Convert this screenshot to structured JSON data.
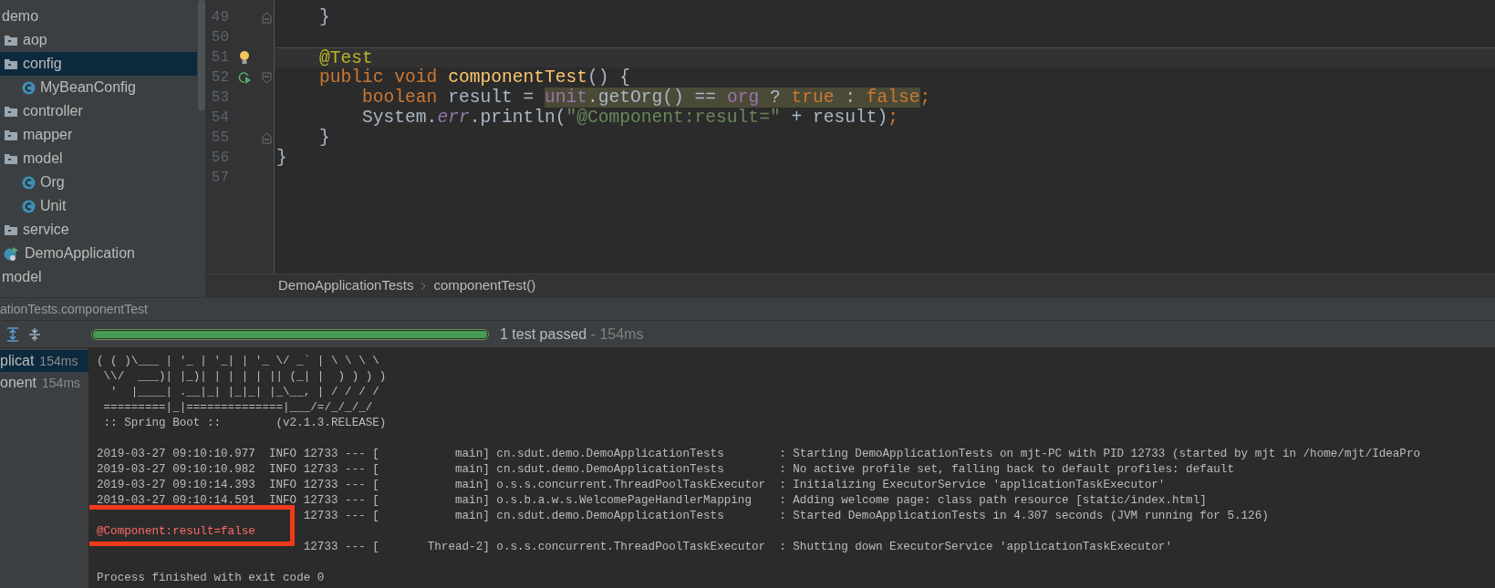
{
  "project_tree": [
    {
      "label": "demo",
      "kind": "module",
      "selected": false,
      "children": [
        {
          "label": "aop",
          "kind": "folder",
          "selected": false
        },
        {
          "label": "config",
          "kind": "folder",
          "selected": true,
          "children": [
            {
              "label": "MyBeanConfig",
              "kind": "class",
              "selected": false
            }
          ]
        },
        {
          "label": "controller",
          "kind": "folder",
          "selected": false
        },
        {
          "label": "mapper",
          "kind": "folder",
          "selected": false
        },
        {
          "label": "model",
          "kind": "folder",
          "selected": false,
          "children": [
            {
              "label": "Org",
              "kind": "class",
              "selected": false
            },
            {
              "label": "Unit",
              "kind": "class",
              "selected": false
            }
          ]
        },
        {
          "label": "service",
          "kind": "folder",
          "selected": false
        },
        {
          "label": "DemoApplication",
          "kind": "app",
          "selected": false
        }
      ]
    },
    {
      "label": "model",
      "kind": "module",
      "selected": false
    }
  ],
  "editor": {
    "lines": [
      {
        "number": "49",
        "fold_end": true,
        "current": false,
        "tokens": [
          {
            "kind": "plain",
            "text": "    }"
          }
        ]
      },
      {
        "number": "50",
        "current": false
      },
      {
        "number": "51",
        "current": true,
        "bulb": true,
        "tokens": [
          {
            "kind": "annotation",
            "text": "    @Test"
          }
        ]
      },
      {
        "number": "52",
        "fold_start": true,
        "current": false,
        "run_marker": true,
        "tokens": [
          {
            "kind": "keyword",
            "text": "    public void "
          },
          {
            "kind": "method",
            "text": "componentTest"
          },
          {
            "kind": "plain",
            "text": "() {"
          }
        ]
      },
      {
        "number": "53",
        "current": false,
        "tokens": [
          {
            "kind": "keyword",
            "text": "        boolean "
          },
          {
            "kind": "plain",
            "text": "result = "
          },
          {
            "kind": "field",
            "text": "unit",
            "marked": true
          },
          {
            "kind": "plain",
            "text": ".getOrg() == ",
            "marked": true
          },
          {
            "kind": "field",
            "text": "org",
            "marked": true
          },
          {
            "kind": "plain",
            "text": " ? ",
            "marked": true
          },
          {
            "kind": "keyword",
            "text": "true",
            "marked": true
          },
          {
            "kind": "plain",
            "text": " : ",
            "marked": true
          },
          {
            "kind": "keyword",
            "text": "false",
            "marked": true
          },
          {
            "kind": "keyword",
            "text": ";"
          }
        ]
      },
      {
        "number": "54",
        "current": false,
        "tokens": [
          {
            "kind": "plain",
            "text": "        System."
          },
          {
            "kind": "static",
            "text": "err"
          },
          {
            "kind": "plain",
            "text": ".println("
          },
          {
            "kind": "string",
            "text": "\"@Component:result=\""
          },
          {
            "kind": "plain",
            "text": " + result)"
          },
          {
            "kind": "keyword",
            "text": ";"
          }
        ]
      },
      {
        "number": "55",
        "fold_end": true,
        "current": false,
        "tokens": [
          {
            "kind": "plain",
            "text": "    }"
          }
        ]
      },
      {
        "number": "56",
        "current": false,
        "tokens": [
          {
            "kind": "plain",
            "text": "}"
          }
        ]
      },
      {
        "number": "57",
        "current": false
      }
    ]
  },
  "breadcrumbs": [
    "DemoApplicationTests",
    "componentTest()"
  ],
  "run_panel": {
    "title": "ationTests.componentTest",
    "progress": {
      "level": 1,
      "status": "1 test passed",
      "time": " - 154ms"
    },
    "tests": [
      {
        "name": "plicat",
        "time": "154ms",
        "selected": true
      },
      {
        "name": "onent",
        "time": "154ms",
        "selected": false
      }
    ],
    "console": [
      {
        "kind": "out",
        "text": "( ( )\\___ | '_ | '_| | '_ \\/ _` | \\ \\ \\ \\"
      },
      {
        "kind": "out",
        "text": " \\\\/  ___)| |_)| | | | | || (_| |  ) ) ) )"
      },
      {
        "kind": "out",
        "text": "  '  |____| .__|_| |_|_| |_\\__, | / / / /"
      },
      {
        "kind": "out",
        "text": " =========|_|==============|___/=/_/_/_/"
      },
      {
        "kind": "out",
        "text": " :: Spring Boot ::        (v2.1.3.RELEASE)"
      },
      {
        "kind": "blank"
      },
      {
        "kind": "out",
        "text": "2019-03-27 09:10:10.977  INFO 12733 --- [           main] cn.sdut.demo.DemoApplicationTests        : Starting DemoApplicationTests on mjt-PC with PID 12733 (started by mjt in /home/mjt/IdeaPro"
      },
      {
        "kind": "out",
        "text": "2019-03-27 09:10:10.982  INFO 12733 --- [           main] cn.sdut.demo.DemoApplicationTests        : No active profile set, falling back to default profiles: default"
      },
      {
        "kind": "out",
        "text": "2019-03-27 09:10:14.393  INFO 12733 --- [           main] o.s.s.concurrent.ThreadPoolTaskExecutor  : Initializing ExecutorService 'applicationTaskExecutor'"
      },
      {
        "kind": "out",
        "text": "2019-03-27 09:10:14.591  INFO 12733 --- [           main] o.s.b.a.w.s.WelcomePageHandlerMapping    : Adding welcome page: class path resource [static/index.html]"
      },
      {
        "kind": "covered",
        "text": "12733 --- [           main] cn.sdut.demo.DemoApplicationTests        : Started DemoApplicationTests in 4.307 seconds (JVM running for 5.126)"
      },
      {
        "kind": "err",
        "text": "@Component:result=false",
        "highlighted": true
      },
      {
        "kind": "covered",
        "text": "12733 --- [       Thread-2] o.s.s.concurrent.ThreadPoolTaskExecutor  : Shutting down ExecutorService 'applicationTaskExecutor'"
      },
      {
        "kind": "blank"
      },
      {
        "kind": "out",
        "text": "Process finished with exit code 0"
      }
    ]
  }
}
